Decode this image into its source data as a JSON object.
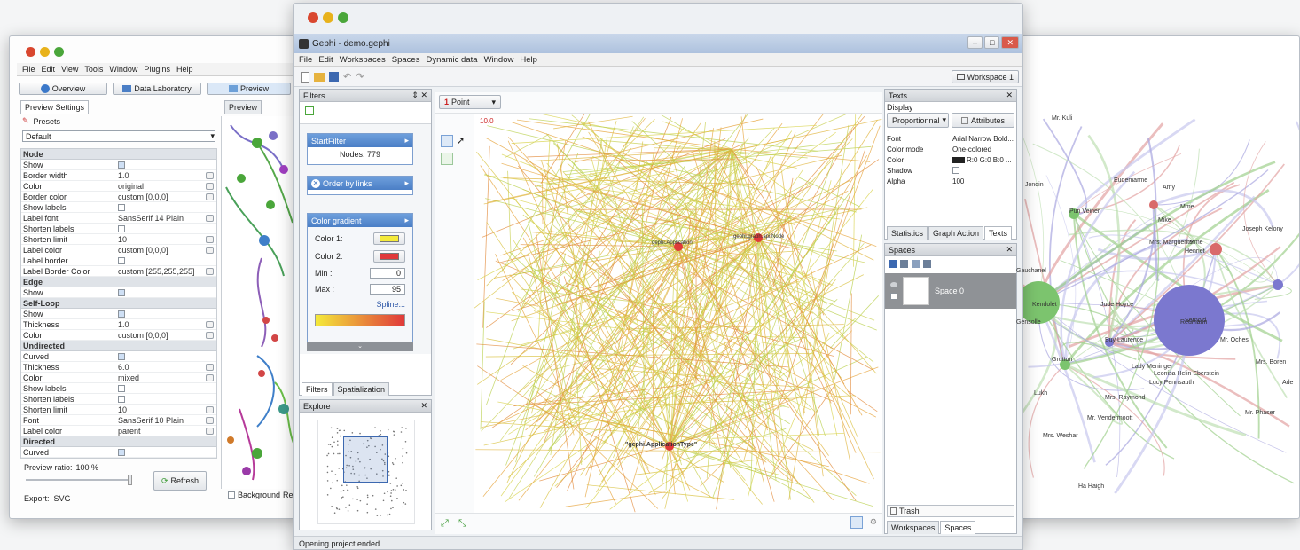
{
  "left": {
    "menu": [
      "File",
      "Edit",
      "View",
      "Tools",
      "Window",
      "Plugins",
      "Help"
    ],
    "tabs": [
      "Overview",
      "Data Laboratory",
      "Preview"
    ],
    "subtab": "Preview Settings",
    "preview_tab": "Preview",
    "presets": "Presets",
    "preset_value": "Default",
    "sections": [
      {
        "title": "Node",
        "rows": [
          [
            "Show",
            "",
            true
          ],
          [
            "Border width",
            "1.0"
          ],
          [
            "Color",
            "original"
          ],
          [
            "Border color",
            "custom [0,0,0]"
          ],
          [
            "Show labels",
            "",
            false
          ],
          [
            "Label font",
            "SansSerif 14 Plain"
          ],
          [
            "Shorten labels",
            "",
            false
          ],
          [
            "Shorten limit",
            "10"
          ],
          [
            "Label color",
            "custom [0,0,0]"
          ],
          [
            "Label border",
            "",
            false
          ],
          [
            "Label Border Color",
            "custom [255,255,255]"
          ]
        ]
      },
      {
        "title": "Edge",
        "rows": [
          [
            "Show",
            "",
            true
          ]
        ]
      },
      {
        "title": "Self-Loop",
        "rows": [
          [
            "Show",
            "",
            true
          ],
          [
            "Thickness",
            "1.0"
          ],
          [
            "Color",
            "custom [0,0,0]"
          ]
        ]
      },
      {
        "title": "Undirected",
        "rows": [
          [
            "Curved",
            "",
            true
          ],
          [
            "Thickness",
            "6.0"
          ],
          [
            "Color",
            "mixed"
          ],
          [
            "Show labels",
            "",
            false
          ],
          [
            "Shorten labels",
            "",
            false
          ],
          [
            "Shorten limit",
            "10"
          ],
          [
            "Font",
            "SansSerif 10 Plain"
          ],
          [
            "Label color",
            "parent"
          ]
        ]
      },
      {
        "title": "Directed",
        "rows": [
          [
            "Curved",
            "",
            true
          ]
        ]
      }
    ],
    "preview_ratio_label": "Preview ratio:",
    "preview_ratio_value": "100 %",
    "refresh": "Refresh",
    "export_label": "Export:",
    "export_value": "SVG",
    "background_label": "Background",
    "background_tail": "Rea"
  },
  "main": {
    "title": "Gephi - demo.gephi",
    "menu": [
      "File",
      "Edit",
      "Workspaces",
      "Spaces",
      "Dynamic data",
      "Window",
      "Help"
    ],
    "workspace_button": "Workspace 1",
    "filters": {
      "title": "Filters",
      "close": "⨯",
      "startfilter": "StartFilter",
      "nodes": "Nodes: 779",
      "order": "Order by links",
      "gradient": "Color gradient",
      "color1": "Color 1:",
      "color2": "Color 2:",
      "color1_hex": "#f4ea3a",
      "color2_hex": "#e0393a",
      "min_label": "Min :",
      "min_value": "0",
      "max_label": "Max :",
      "max_value": "95",
      "spline": "Spline...",
      "tabs": [
        "Filters",
        "Spatialization"
      ]
    },
    "explore": {
      "title": "Explore"
    },
    "graph": {
      "point_value": "1",
      "point_unit": "Point",
      "scale_label": "10.0",
      "labels": [
        "gephi.Application",
        "gephi.graph.api.Node",
        "\"gephi.ApplicationType\""
      ]
    },
    "texts_panel": {
      "title": "Texts",
      "display": "Display",
      "mode": "Proportionnal",
      "attributes": "Attributes",
      "rows": [
        [
          "Font",
          "Arial Narrow Bold..."
        ],
        [
          "Color mode",
          "One-colored"
        ],
        [
          "Color",
          "R:0 G:0 B:0 ..."
        ],
        [
          "Shadow",
          ""
        ],
        [
          "Alpha",
          "100"
        ]
      ],
      "tabs": [
        "Statistics",
        "Graph Action",
        "Texts"
      ]
    },
    "spaces_panel": {
      "title": "Spaces",
      "space": "Space 0",
      "trash": "Trash",
      "tabs": [
        "Workspaces",
        "Spaces"
      ]
    },
    "status": "Opening project ended"
  },
  "right": {
    "labels": [
      "Mr. Kuli",
      "Jondin",
      "Eudemarme",
      "Pun Veiner",
      "Amy",
      "Mme",
      "Mike",
      "Mrs. Marguerite",
      "Mme",
      "Henriet",
      "Joseph Kelony",
      "Gauchanel",
      "Kendolet",
      "Jude Hoyce",
      "Gensolle",
      "Grutton",
      "Reumarin",
      "Buy Laurence",
      "Lady Meninger",
      "Leonisa Helin Eberstein",
      "Lucy Pennsauth",
      "Mrs. Raymond",
      "Mr. Oches",
      "Mrs. Boren",
      "Lukh",
      "Mr. Vendermoott",
      "Mr. Phaser",
      "Ade",
      "Mrs. Weshar",
      "Ha Haigh",
      "Sernold"
    ]
  }
}
